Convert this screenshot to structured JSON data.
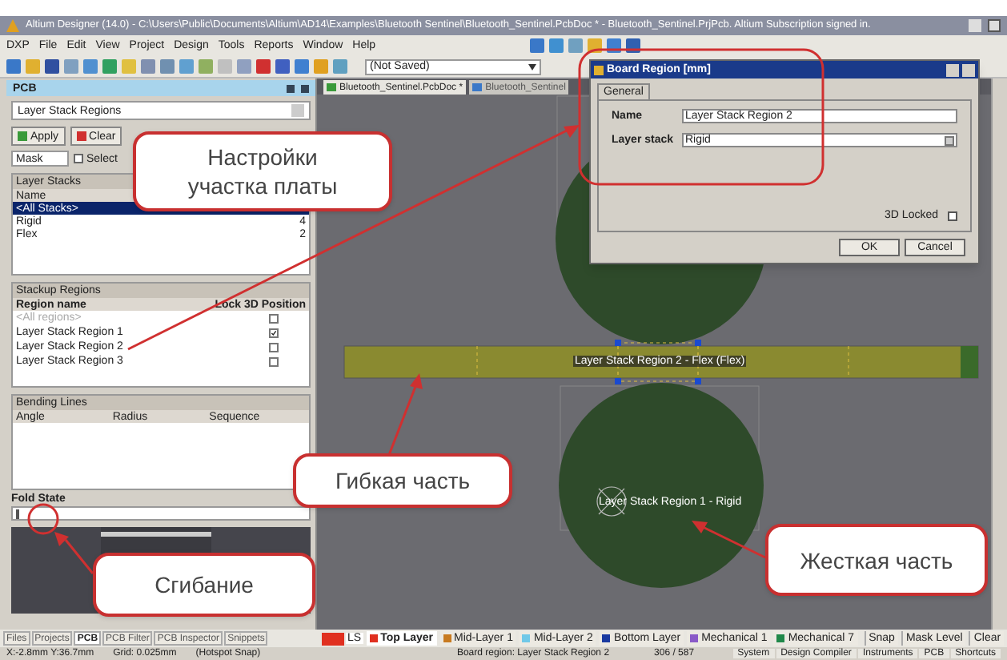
{
  "window": {
    "title": "Altium Designer (14.0) - C:\\Users\\Public\\Documents\\Altium\\AD14\\Examples\\Bluetooth Sentinel\\Bluetooth_Sentinel.PcbDoc * - Bluetooth_Sentinel.PrjPcb. Altium Subscription signed in."
  },
  "menu": [
    "DXP",
    "File",
    "Edit",
    "View",
    "Project",
    "Design",
    "Tools",
    "Reports",
    "Window",
    "Help"
  ],
  "toolbar": {
    "combo": "(Not Saved)"
  },
  "panel": {
    "title": "PCB",
    "mode": "Layer Stack Regions",
    "buttons": [
      "Apply",
      "Clear"
    ],
    "mask": "Mask",
    "select": {
      "label": "Select",
      "checked": false
    },
    "layer_stacks": {
      "title": "Layer Stacks",
      "columns": [
        "Name"
      ],
      "rows": [
        {
          "name": "<All Stacks>",
          "selected": true
        },
        {
          "name": "Rigid",
          "count": "4",
          "selected": false
        },
        {
          "name": "Flex",
          "count": "2",
          "selected": false
        }
      ]
    },
    "stackup_regions": {
      "title": "Stackup Regions",
      "columns": [
        "Region name",
        "Lock 3D Position"
      ],
      "rows": [
        {
          "name": "<All regions>",
          "dimmed": true,
          "locked": false
        },
        {
          "name": "Layer Stack Region 1",
          "dimmed": false,
          "locked": true
        },
        {
          "name": "Layer Stack Region 2",
          "dimmed": false,
          "locked": false
        },
        {
          "name": "Layer Stack Region 3",
          "dimmed": false,
          "locked": false
        }
      ]
    },
    "bending_lines": {
      "title": "Bending Lines",
      "columns": [
        "Angle",
        "Radius",
        "Sequence"
      ]
    },
    "fold_state": {
      "label": "Fold State",
      "level": 0
    }
  },
  "panel_tabs": [
    {
      "label": "Files",
      "selected": false
    },
    {
      "label": "Projects",
      "selected": false
    },
    {
      "label": "PCB",
      "selected": true
    },
    {
      "label": "PCB Filter",
      "selected": false
    },
    {
      "label": "PCB Inspector",
      "selected": false
    },
    {
      "label": "Snippets",
      "selected": false
    }
  ],
  "doc_tabs": [
    {
      "label": "Bluetooth_Sentinel.PcbDoc *",
      "selected": true
    },
    {
      "label": "Bluetooth_Sentinel",
      "selected": false
    }
  ],
  "canvas": {
    "flex_label": "Layer Stack Region 2 - Flex (Flex)",
    "rigid_label": "Layer Stack Region 1 - Rigid"
  },
  "dialog": {
    "title": "Board Region [mm]",
    "tabs": [
      {
        "label": "General",
        "selected": true
      }
    ],
    "fields": [
      {
        "label": "Name",
        "value": "Layer Stack Region 2",
        "kind": "text"
      },
      {
        "label": "Layer stack",
        "value": "Rigid",
        "kind": "select"
      }
    ],
    "locked": {
      "label": "3D Locked",
      "checked": false
    },
    "buttons": [
      "OK",
      "Cancel"
    ]
  },
  "layer_bar": {
    "current": "LS",
    "layers": [
      {
        "label": "Top Layer",
        "color": "#e03020",
        "selected": true
      },
      {
        "label": "Mid-Layer 1",
        "color": "#c87a20",
        "selected": false
      },
      {
        "label": "Mid-Layer 2",
        "color": "#70c8e8",
        "selected": false
      },
      {
        "label": "Bottom Layer",
        "color": "#1a3aa0",
        "selected": false
      },
      {
        "label": "Mechanical 1",
        "color": "#8a5ac8",
        "selected": false
      },
      {
        "label": "Mechanical 7",
        "color": "#20884a",
        "selected": false
      }
    ],
    "controls": [
      "Snap",
      "Mask Level",
      "Clear"
    ]
  },
  "status_bar": {
    "position": "X:-2.8mm Y:36.7mm",
    "grid": "Grid: 0.025mm",
    "snap": "(Hotspot Snap)",
    "message": "Board region: Layer Stack Region 2",
    "counter": "306 / 587",
    "buttons": [
      "System",
      "Design Compiler",
      "Instruments",
      "PCB",
      "Shortcuts"
    ]
  },
  "callouts": [
    {
      "text": "Настройки участка платы"
    },
    {
      "text": "Гибкая часть"
    },
    {
      "text": "Сгибание"
    },
    {
      "text": "Жесткая часть"
    }
  ]
}
